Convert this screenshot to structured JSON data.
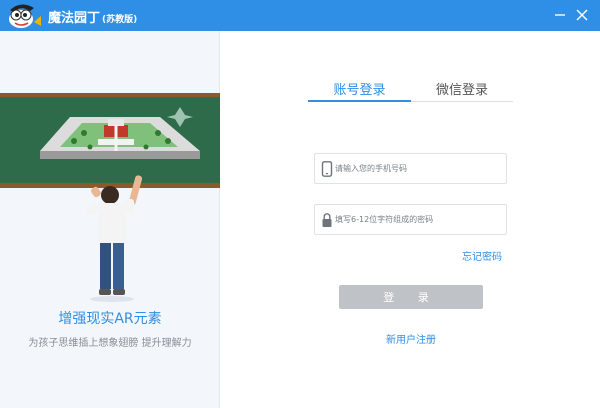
{
  "app": {
    "title": "魔法园丁",
    "edition": "(苏教版)",
    "brand_color": "#2f8ee6"
  },
  "window_controls": {
    "minimize_icon": "minimize-icon",
    "close_icon": "close-icon"
  },
  "promo": {
    "title": "增强现实AR元素",
    "subtitle": "为孩子思维插上想象翅膀 提升理解力"
  },
  "tabs": [
    {
      "label": "账号登录",
      "active": true
    },
    {
      "label": "微信登录",
      "active": false
    }
  ],
  "form": {
    "phone": {
      "placeholder": "请输入您的手机号码",
      "value": "",
      "icon": "phone-icon"
    },
    "password": {
      "placeholder": "填写6-12位字符组成的密码",
      "value": "",
      "icon": "lock-icon"
    },
    "forgot_label": "忘记密码",
    "login_label": "登 录",
    "register_label": "新用户注册"
  }
}
